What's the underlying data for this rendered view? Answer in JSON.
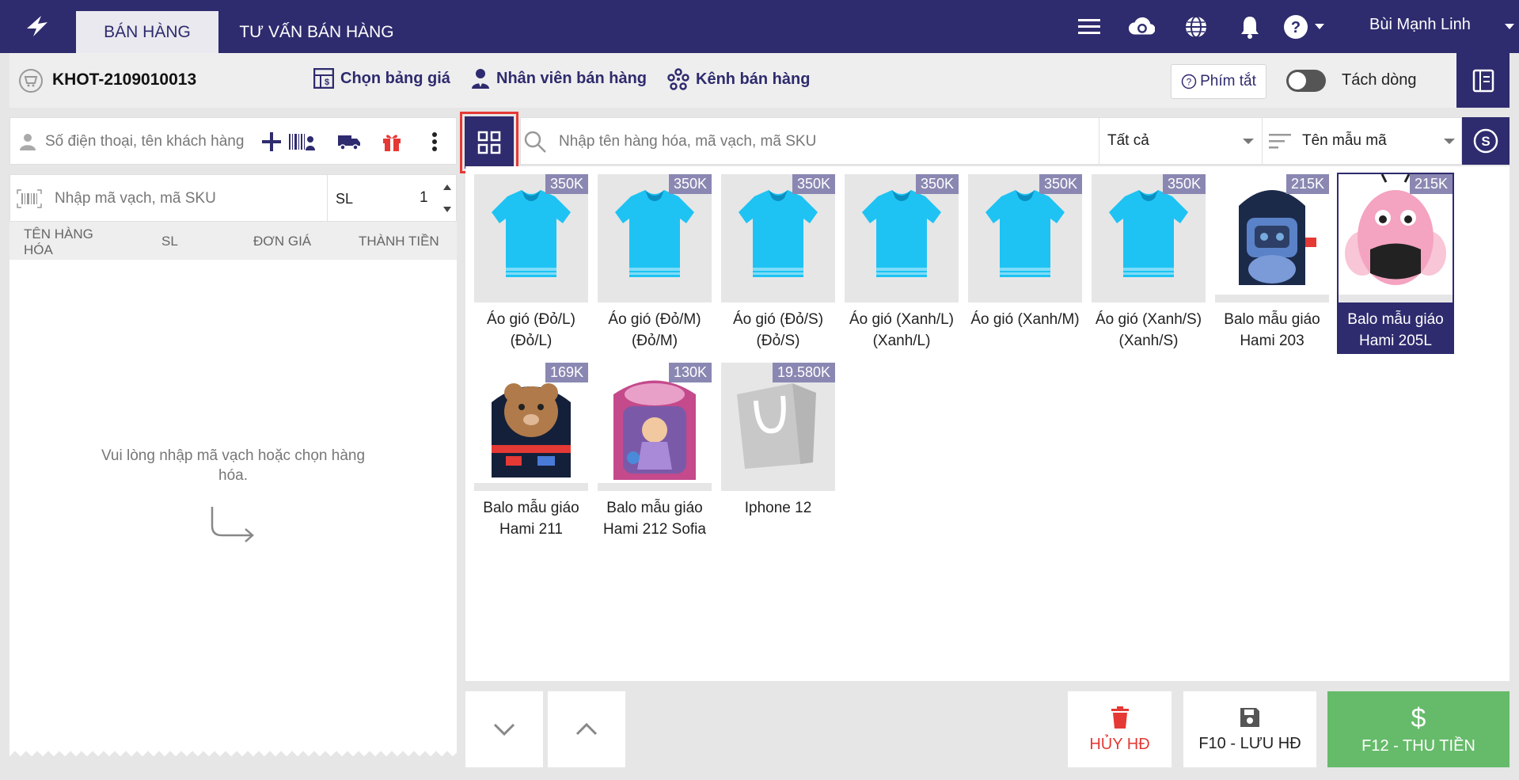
{
  "topbar": {
    "tabs": [
      {
        "label": "BÁN HÀNG"
      },
      {
        "label": "TƯ VẤN BÁN HÀNG"
      }
    ],
    "username": "Bùi Mạnh Linh"
  },
  "secbar": {
    "order_code": "KHOT-2109010013",
    "price_list_label": "Chọn bảng giá",
    "staff_label": "Nhân viên bán hàng",
    "channel_label": "Kênh bán hàng",
    "shortcut_label": "Phím tắt",
    "split_line_label": "Tách dòng",
    "split_line_on": false
  },
  "cart": {
    "customer_placeholder": "Số điện thoại, tên khách hàng",
    "sku_placeholder": "Nhập mã vạch, mã SKU",
    "qty_label": "SL",
    "qty_value": "1",
    "columns": [
      "TÊN HÀNG HÓA",
      "SL",
      "ĐƠN GIÁ",
      "THÀNH TIỀN"
    ],
    "empty_message": "Vui lòng nhập mã vạch hoặc chọn hàng hóa."
  },
  "search": {
    "placeholder": "Nhập tên hàng hóa, mã vạch, mã SKU",
    "category_selected": "Tất cả",
    "sort_selected": "Tên mẫu mã"
  },
  "products": [
    {
      "name": "Áo gió (Đỏ/L) (Đỏ/L)",
      "price": "350K",
      "image": "shirt"
    },
    {
      "name": "Áo gió (Đỏ/M) (Đỏ/M)",
      "price": "350K",
      "image": "shirt"
    },
    {
      "name": "Áo gió (Đỏ/S) (Đỏ/S)",
      "price": "350K",
      "image": "shirt"
    },
    {
      "name": "Áo gió (Xanh/L) (Xanh/L)",
      "price": "350K",
      "image": "shirt"
    },
    {
      "name": "Áo gió (Xanh/M)",
      "price": "350K",
      "image": "shirt"
    },
    {
      "name": "Áo gió (Xanh/S) (Xanh/S)",
      "price": "350K",
      "image": "shirt"
    },
    {
      "name": "Balo mẫu giáo Hami 203",
      "price": "215K",
      "image": "backpack-robot"
    },
    {
      "name": "Balo mẫu giáo Hami 205L",
      "price": "215K",
      "image": "backpack-bee",
      "selected": true
    },
    {
      "name": "Balo mẫu giáo Hami 211",
      "price": "169K",
      "image": "backpack-bear"
    },
    {
      "name": "Balo mẫu giáo Hami 212 Sofia",
      "price": "130K",
      "image": "backpack-sofia"
    },
    {
      "name": "Iphone 12",
      "price": "19.580K",
      "image": "shopping-bag"
    }
  ],
  "actions": {
    "cancel_label": "HỦY HĐ",
    "save_label": "F10 - LƯU HĐ",
    "pay_label": "F12 - THU TIỀN"
  },
  "colors": {
    "primary": "#2e2b6e",
    "cancel": "#e53935",
    "pay": "#66bb6a",
    "price_badge": "#8a88b2",
    "highlight_border": "#e53935"
  }
}
